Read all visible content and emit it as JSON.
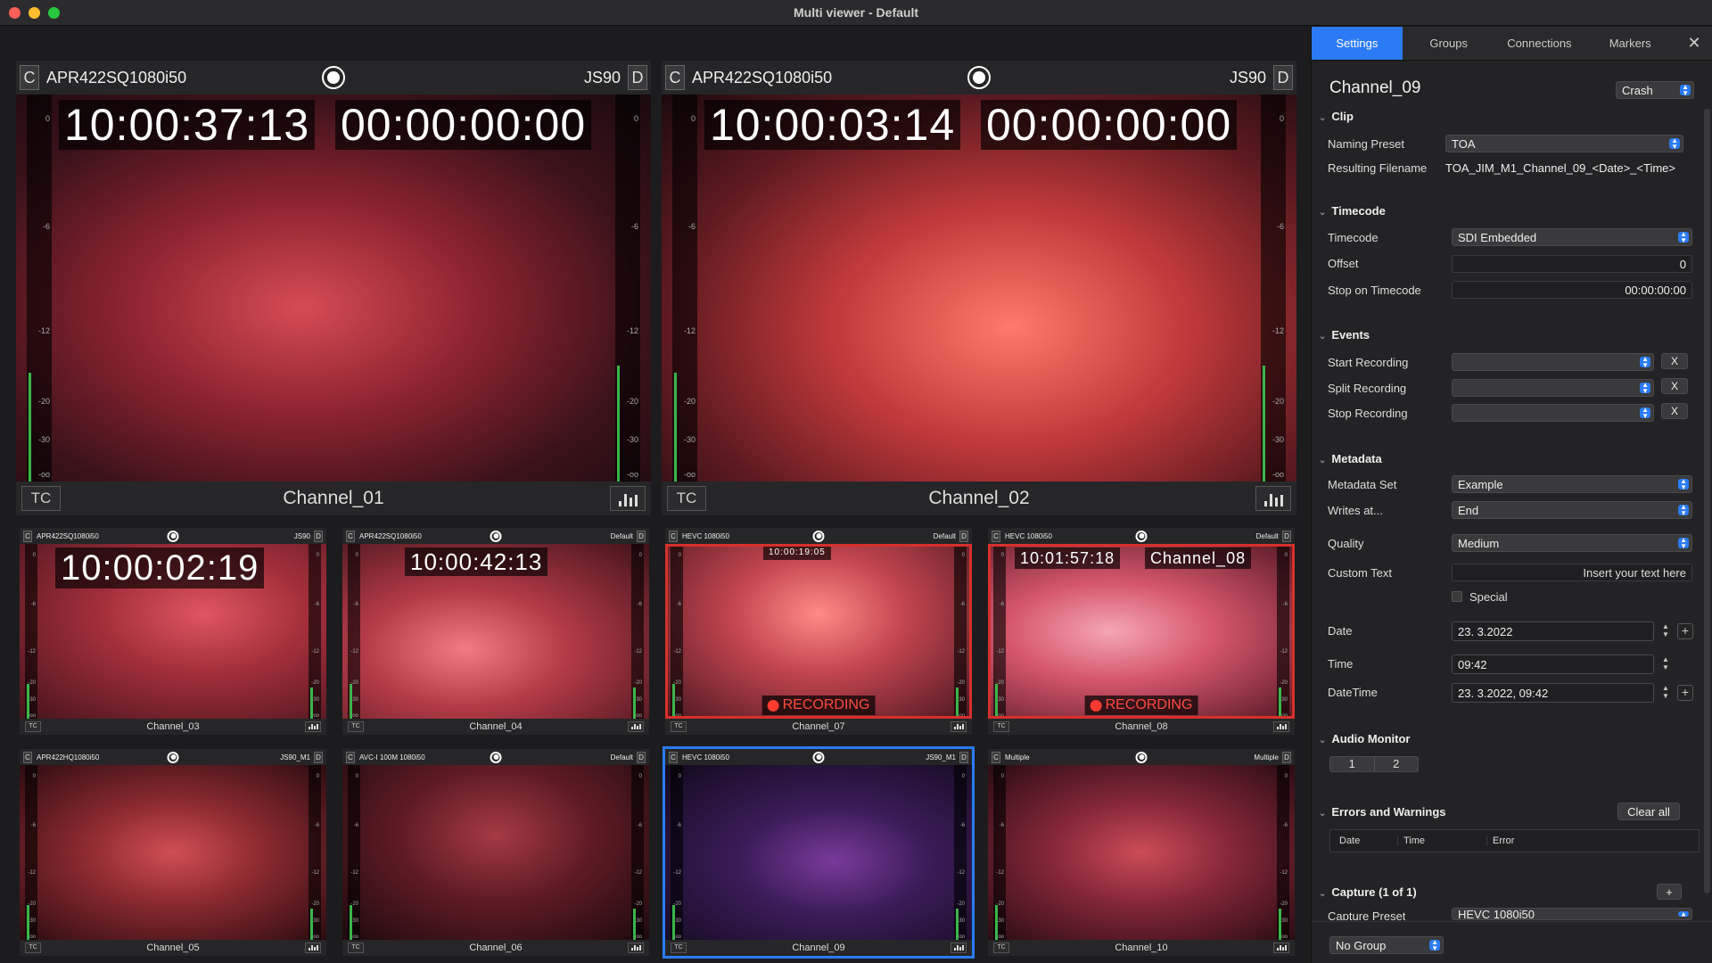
{
  "window": {
    "title": "Multi viewer - Default"
  },
  "colors": {
    "accent": "#2a7bf5",
    "recording": "#d6302b",
    "meter_green": "#3ab54a"
  },
  "tiles": [
    {
      "channel": "Channel_01",
      "format": "APR422SQ1080i50",
      "preset": "JS90",
      "c_label": "C",
      "d_label": "D",
      "timecode": "10:00:37:13",
      "timecode2": "00:00:00:00",
      "tc_label": "TC",
      "scale": [
        "0",
        "-6",
        "-12",
        "-20",
        "-30",
        "-oo"
      ]
    },
    {
      "channel": "Channel_02",
      "format": "APR422SQ1080i50",
      "preset": "JS90",
      "c_label": "C",
      "d_label": "D",
      "timecode": "10:00:03:14",
      "timecode2": "00:00:00:00",
      "tc_label": "TC",
      "scale": [
        "0",
        "-6",
        "-12",
        "-20",
        "-30",
        "-oo"
      ]
    },
    {
      "channel": "Channel_03",
      "format": "APR422SQ1080i50",
      "preset": "JS90",
      "c_label": "C",
      "d_label": "D",
      "timecode": "10:00:02:19",
      "tc_label": "TC"
    },
    {
      "channel": "Channel_04",
      "format": "APR422SQ1080i50",
      "preset": "Default",
      "c_label": "C",
      "d_label": "D",
      "timecode": "10:00:42:13",
      "tc_label": "TC"
    },
    {
      "channel": "Channel_07",
      "format": "HEVC 1080i50",
      "preset": "Default",
      "c_label": "C",
      "d_label": "D",
      "timecode": "10:00:19:05",
      "recording": "RECORDING",
      "tc_label": "TC"
    },
    {
      "channel": "Channel_08",
      "format": "HEVC 1080i50",
      "preset": "Default",
      "c_label": "C",
      "d_label": "D",
      "timecode": "10:01:57:18",
      "channel_overlay": "Channel_08",
      "recording": "RECORDING",
      "tc_label": "TC"
    },
    {
      "channel": "Channel_05",
      "format": "APR422HQ1080i50",
      "preset": "JS90_M1",
      "c_label": "C",
      "d_label": "D",
      "tc_label": "TC"
    },
    {
      "channel": "Channel_06",
      "format": "AVC-I 100M 1080i50",
      "preset": "Default",
      "c_label": "C",
      "d_label": "D",
      "tc_label": "TC"
    },
    {
      "channel": "Channel_09",
      "format": "HEVC 1080i50",
      "preset": "JS90_M1",
      "c_label": "C",
      "d_label": "D",
      "tc_label": "TC"
    },
    {
      "channel": "Channel_10",
      "format": "Multiple",
      "preset": "Multiple",
      "c_label": "C",
      "d_label": "D",
      "tc_label": "TC"
    }
  ],
  "small_scale": [
    "0",
    "-6",
    "-12",
    "-20",
    "-30",
    "-oo"
  ],
  "panel": {
    "tabs": [
      "Settings",
      "Groups",
      "Connections",
      "Markers"
    ],
    "active_tab": "Settings",
    "close_icon": "close-icon",
    "channel_name": "Channel_09",
    "channel_menu": "Crash",
    "clip": {
      "header": "Clip",
      "naming_preset_label": "Naming Preset",
      "naming_preset": "TOA",
      "resulting_filename_label": "Resulting Filename",
      "resulting_filename": "TOA_JIM_M1_Channel_09_<Date>_<Time>"
    },
    "timecode": {
      "header": "Timecode",
      "timecode_label": "Timecode",
      "timecode": "SDI Embedded",
      "offset_label": "Offset",
      "offset": "0",
      "stop_label": "Stop on Timecode",
      "stop": "00:00:00:00"
    },
    "events": {
      "header": "Events",
      "start_label": "Start Recording",
      "split_label": "Split Recording",
      "stop_label": "Stop Recording",
      "x": "X"
    },
    "metadata": {
      "header": "Metadata",
      "set_label": "Metadata Set",
      "set": "Example",
      "writes_label": "Writes at...",
      "writes": "End",
      "quality_label": "Quality",
      "quality": "Medium",
      "custom_label": "Custom Text",
      "custom_placeholder": "Insert your text here",
      "special_label": "Special",
      "date_label": "Date",
      "date": "23. 3.2022",
      "time_label": "Time",
      "time": "09:42",
      "datetime_label": "DateTime",
      "datetime": "23. 3.2022, 09:42"
    },
    "audio": {
      "header": "Audio Monitor",
      "ch1": "1",
      "ch2": "2"
    },
    "errors": {
      "header": "Errors and Warnings",
      "clear": "Clear all",
      "col_date": "Date",
      "col_time": "Time",
      "col_error": "Error"
    },
    "capture": {
      "header": "Capture (1 of 1)",
      "add": "+",
      "preset_label": "Capture Preset",
      "preset": "HEVC 1080i50"
    },
    "group": "No Group"
  }
}
